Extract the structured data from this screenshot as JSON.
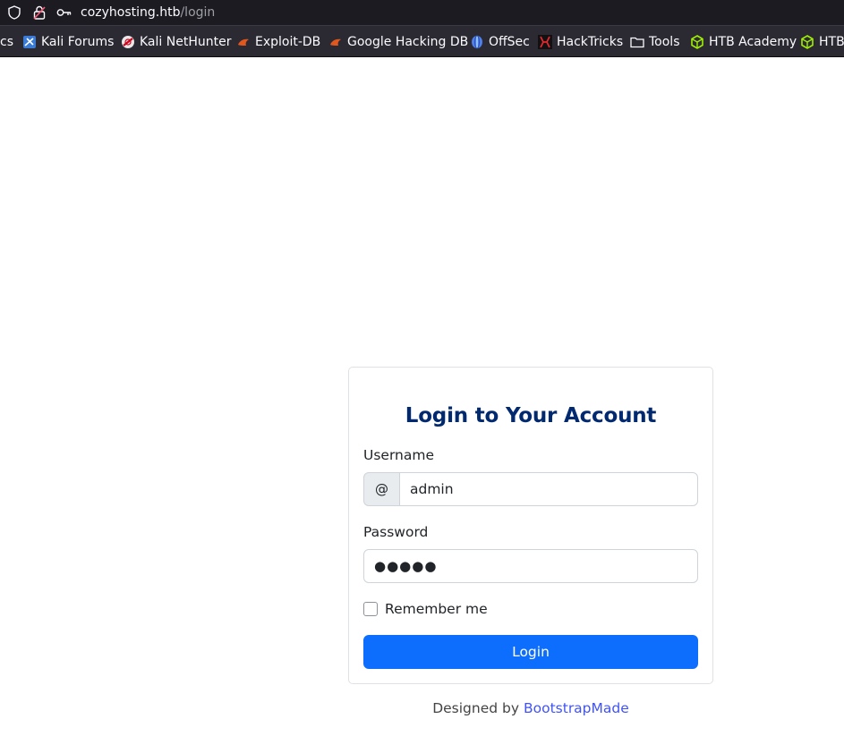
{
  "browser": {
    "url_host": "cozyhosting.htb",
    "url_path": "/login",
    "bookmarks": [
      {
        "label": "cs",
        "icon": "kali-docs-icon"
      },
      {
        "label": "Kali Forums",
        "icon": "kali-forums-icon"
      },
      {
        "label": "Kali NetHunter",
        "icon": "kali-nethunter-icon"
      },
      {
        "label": "Exploit-DB",
        "icon": "exploit-db-icon"
      },
      {
        "label": "Google Hacking DB",
        "icon": "ghdb-icon"
      },
      {
        "label": "OffSec",
        "icon": "offsec-icon"
      },
      {
        "label": "HackTricks",
        "icon": "hacktricks-icon"
      },
      {
        "label": "Tools",
        "icon": "folder-icon"
      },
      {
        "label": "HTB Academy",
        "icon": "htb-icon"
      },
      {
        "label": "HTB",
        "icon": "htb-icon"
      }
    ]
  },
  "login": {
    "title": "Login to Your Account",
    "username_label": "Username",
    "username_addon": "@",
    "username_value": "admin",
    "password_label": "Password",
    "password_value": "●●●●●",
    "remember_label": "Remember me",
    "remember_checked": false,
    "submit_label": "Login"
  },
  "footer": {
    "prefix": "Designed by",
    "link_text": "BootstrapMade"
  },
  "colors": {
    "primary_button": "#0d6efd",
    "title": "#012970",
    "link": "#4154f1"
  }
}
